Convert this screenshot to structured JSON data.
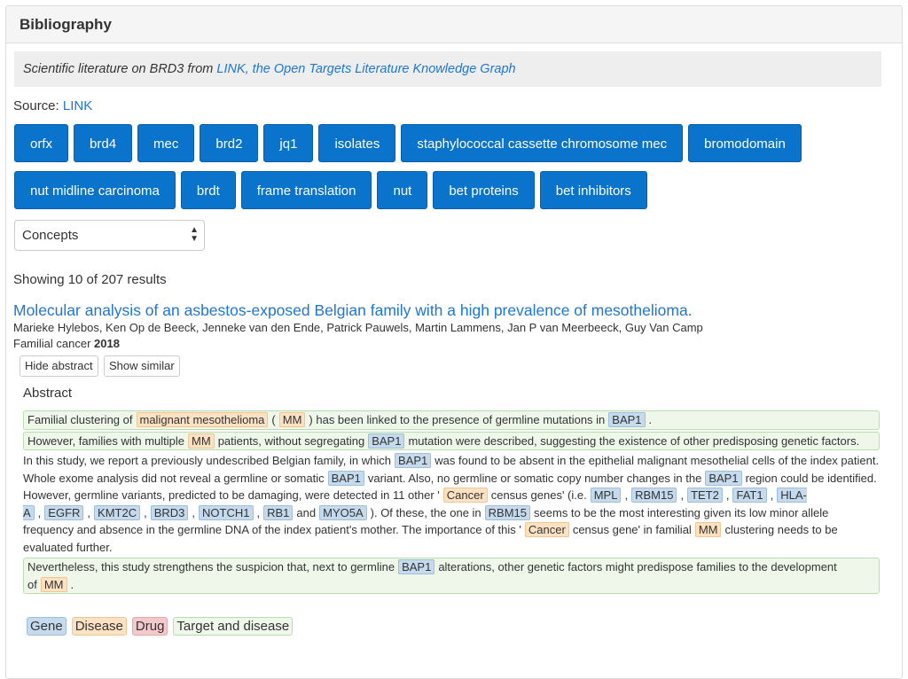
{
  "panel": {
    "title": "Bibliography"
  },
  "description": {
    "prefix": "Scientific literature on BRD3 from ",
    "link": "LINK, the Open Targets Literature Knowledge Graph"
  },
  "source": {
    "label": "Source: ",
    "link": "LINK"
  },
  "concept_tags": [
    "orfx",
    "brd4",
    "mec",
    "brd2",
    "jq1",
    "isolates",
    "staphylococcal cassette chromosome mec",
    "bromodomain",
    "nut midline carcinoma",
    "brdt",
    "frame translation",
    "nut",
    "bet proteins",
    "bet inhibitors"
  ],
  "select": {
    "value": "Concepts"
  },
  "results": {
    "showing": "Showing 10 of 207 results"
  },
  "article": {
    "title": "Molecular analysis of an asbestos-exposed Belgian family with a high prevalence of mesothelioma.",
    "authors": "Marieke Hylebos, Ken Op de Beeck, Jenneke van den Ende, Patrick Pauwels, Martin Lammens, Jan P van Meerbeeck, Guy Van Camp",
    "journal": "Familial cancer",
    "year": "2018",
    "hide_abstract": "Hide abstract",
    "show_similar": "Show similar",
    "abstract_heading": "Abstract",
    "abstract": {
      "s1": [
        "Familial clustering of",
        "malignant mesothelioma",
        "(",
        "MM",
        ") has been linked to the presence of germline mutations in",
        "BAP1",
        "."
      ],
      "s2": [
        "However, families with multiple",
        "MM",
        "patients, without segregating",
        "BAP1",
        "mutation were described, suggesting the existence of other predisposing genetic factors."
      ],
      "p3": [
        "In this study, we report a previously undescribed Belgian family, in which",
        "BAP1",
        "was found to be absent in the epithelial malignant mesothelial cells of the index patient. Whole exome analysis did not reveal a germline or somatic",
        "BAP1",
        "variant. Also, no germline or somatic copy number changes in the",
        "BAP1",
        "region could be identified. However, germline variants, predicted to be damaging, were detected in 11 other '",
        "Cancer",
        "census genes' (i.e.",
        "MPL",
        ",",
        "RBM15",
        ",",
        "TET2",
        ",",
        "FAT1",
        ",",
        "HLA-A",
        ",",
        "EGFR",
        ",",
        "KMT2C",
        ",",
        "BRD3",
        ",",
        "NOTCH1",
        ",",
        "RB1",
        "and",
        "MYO5A",
        "). Of these, the one in",
        "RBM15",
        "seems to be the most interesting given its low minor allele frequency and absence in the germline DNA of the index patient's mother. The importance of this '",
        "Cancer",
        "census gene' in familial",
        "MM",
        "clustering needs to be evaluated further."
      ],
      "s4": [
        "Nevertheless, this study strengthens the suspicion that, next to germline",
        "BAP1",
        "alterations, other genetic factors might predispose families to the development of",
        "MM",
        "."
      ]
    }
  },
  "legend": {
    "gene": "Gene",
    "disease": "Disease",
    "drug": "Drug",
    "target_disease": "Target and disease"
  }
}
